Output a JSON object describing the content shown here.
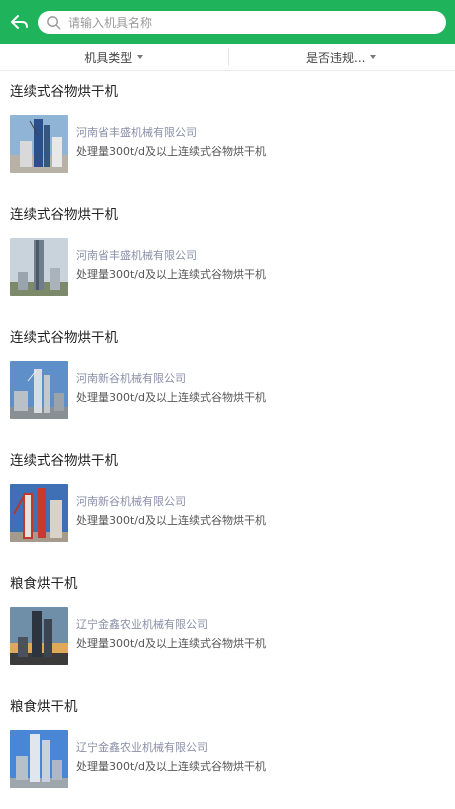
{
  "header": {
    "back_icon": "back-arrow-icon",
    "search_icon": "search-icon",
    "search_placeholder": "请输入机具名称",
    "search_value": ""
  },
  "filters": [
    {
      "label": "机具类型"
    },
    {
      "label": "是否违规..."
    }
  ],
  "items": [
    {
      "title": "连续式谷物烘干机",
      "company": "河南省丰盛机械有限公司",
      "desc": "处理量300t/d及以上连续式谷物烘干机"
    },
    {
      "title": "连续式谷物烘干机",
      "company": "河南省丰盛机械有限公司",
      "desc": "处理量300t/d及以上连续式谷物烘干机"
    },
    {
      "title": "连续式谷物烘干机",
      "company": "河南新谷机械有限公司",
      "desc": "处理量300t/d及以上连续式谷物烘干机"
    },
    {
      "title": "连续式谷物烘干机",
      "company": "河南新谷机械有限公司",
      "desc": "处理量300t/d及以上连续式谷物烘干机"
    },
    {
      "title": "粮食烘干机",
      "company": "辽宁金鑫农业机械有限公司",
      "desc": "处理量300t/d及以上连续式谷物烘干机"
    },
    {
      "title": "粮食烘干机",
      "company": "辽宁金鑫农业机械有限公司",
      "desc": "处理量300t/d及以上连续式谷物烘干机"
    }
  ],
  "colors": {
    "header_bg": "#1fb35b",
    "company_text": "#8a8fa8"
  }
}
